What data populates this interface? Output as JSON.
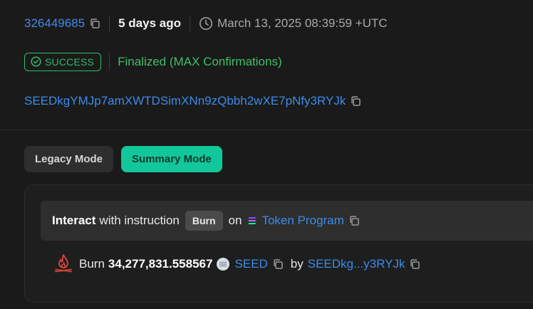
{
  "tx": {
    "slot": "326449685",
    "age": "5 days ago",
    "timestamp": "March 13, 2025 08:39:59 +UTC",
    "status": "SUCCESS",
    "confirmation": "Finalized (MAX Confirmations)",
    "signer": "SEEDkgYMJp7amXWTDSimXNn9zQbbh2wXE7pNfy3RYJk"
  },
  "modes": {
    "legacy_label": "Legacy Mode",
    "summary_label": "Summary Mode",
    "active": "Summary Mode"
  },
  "instruction": {
    "interact_label": "Interact",
    "with_label": "with instruction",
    "name": "Burn",
    "on_label": "on",
    "program": "Token Program"
  },
  "action": {
    "verb": "Burn",
    "amount": "34,277,831.558567",
    "token": "SEED",
    "by_label": "by",
    "owner_short": "SEEDkg...y3RYJk"
  },
  "colors": {
    "accent": "#12c79a",
    "link": "#3d8be8",
    "success": "#2fbb6a"
  }
}
